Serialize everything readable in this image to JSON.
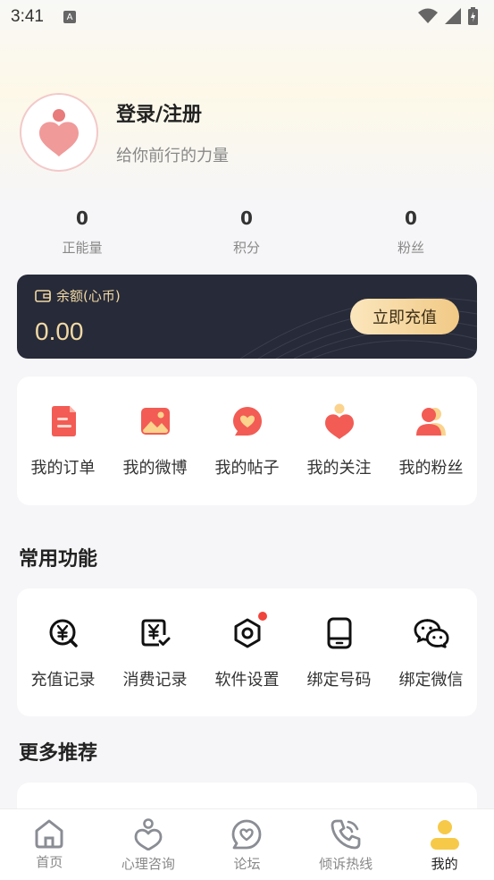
{
  "status_bar": {
    "time": "3:41",
    "indicator": "A"
  },
  "profile": {
    "title": "登录/注册",
    "subtitle": "给你前行的力量"
  },
  "stats": [
    {
      "value": "0",
      "label": "正能量"
    },
    {
      "value": "0",
      "label": "积分"
    },
    {
      "value": "0",
      "label": "粉丝"
    }
  ],
  "balance": {
    "label": "余额(心币)",
    "value": "0.00",
    "button": "立即充值"
  },
  "shortcuts": [
    {
      "label": "我的订单",
      "icon": "order-icon"
    },
    {
      "label": "我的微博",
      "icon": "image-icon"
    },
    {
      "label": "我的帖子",
      "icon": "heart-chat-icon"
    },
    {
      "label": "我的关注",
      "icon": "heart-person-icon"
    },
    {
      "label": "我的粉丝",
      "icon": "fans-icon"
    }
  ],
  "common": {
    "title": "常用功能",
    "items": [
      {
        "label": "充值记录",
        "icon": "yen-search-icon"
      },
      {
        "label": "消费记录",
        "icon": "yen-check-icon"
      },
      {
        "label": "软件设置",
        "icon": "settings-icon"
      },
      {
        "label": "绑定号码",
        "icon": "phone-icon"
      },
      {
        "label": "绑定微信",
        "icon": "wechat-icon"
      }
    ]
  },
  "more": {
    "title": "更多推荐"
  },
  "tabbar": [
    {
      "label": "首页",
      "icon": "home-icon"
    },
    {
      "label": "心理咨询",
      "icon": "counsel-icon"
    },
    {
      "label": "论坛",
      "icon": "forum-icon"
    },
    {
      "label": "倾诉热线",
      "icon": "hotline-icon"
    },
    {
      "label": "我的",
      "icon": "me-icon",
      "active": true
    }
  ],
  "colors": {
    "accent": "#f25c54",
    "gold": "#f1d9a5",
    "active_tab": "#f7c948"
  }
}
